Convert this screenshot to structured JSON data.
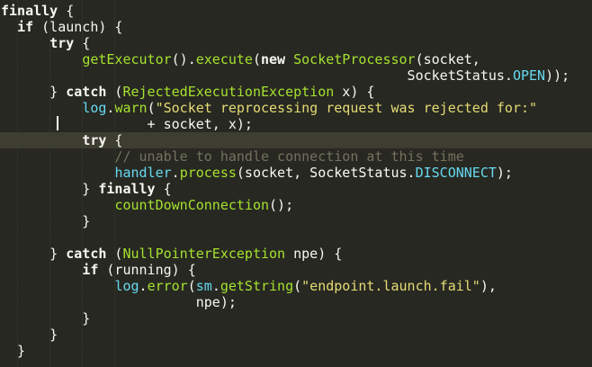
{
  "editor": {
    "lines": [
      [
        {
          "t": "finally",
          "c": "tok-kw"
        },
        {
          "t": " {",
          "c": "tok-plain"
        }
      ],
      [
        {
          "t": "  ",
          "c": "tok-plain"
        },
        {
          "t": "if",
          "c": "tok-kw"
        },
        {
          "t": " (launch) {",
          "c": "tok-plain"
        }
      ],
      [
        {
          "t": "      ",
          "c": "tok-plain"
        },
        {
          "t": "try",
          "c": "tok-kw"
        },
        {
          "t": " {",
          "c": "tok-plain"
        }
      ],
      [
        {
          "t": "          ",
          "c": "tok-plain"
        },
        {
          "t": "getExecutor",
          "c": "tok-fn"
        },
        {
          "t": "().",
          "c": "tok-plain"
        },
        {
          "t": "execute",
          "c": "tok-fn"
        },
        {
          "t": "(",
          "c": "tok-plain"
        },
        {
          "t": "new",
          "c": "tok-kw"
        },
        {
          "t": " ",
          "c": "tok-plain"
        },
        {
          "t": "SocketProcessor",
          "c": "tok-type"
        },
        {
          "t": "(socket,",
          "c": "tok-plain"
        }
      ],
      [
        {
          "t": "                                                  SocketStatus.",
          "c": "tok-plain"
        },
        {
          "t": "OPEN",
          "c": "tok-const"
        },
        {
          "t": "));",
          "c": "tok-plain"
        }
      ],
      [
        {
          "t": "      } ",
          "c": "tok-plain"
        },
        {
          "t": "catch",
          "c": "tok-kw"
        },
        {
          "t": " (",
          "c": "tok-plain"
        },
        {
          "t": "RejectedExecutionException",
          "c": "tok-type"
        },
        {
          "t": " x) {",
          "c": "tok-plain"
        }
      ],
      [
        {
          "t": "          ",
          "c": "tok-plain"
        },
        {
          "t": "log",
          "c": "tok-const"
        },
        {
          "t": ".",
          "c": "tok-plain"
        },
        {
          "t": "warn",
          "c": "tok-fn"
        },
        {
          "t": "(",
          "c": "tok-plain"
        },
        {
          "t": "\"Socket reprocessing request was rejected for:\"",
          "c": "tok-str"
        }
      ],
      [
        {
          "t": "                  + socket, x);",
          "c": "tok-plain"
        }
      ],
      [
        {
          "t": "          ",
          "c": "tok-plain"
        },
        {
          "t": "try",
          "c": "tok-kw"
        },
        {
          "t": " {",
          "c": "tok-plain"
        }
      ],
      [
        {
          "t": "              ",
          "c": "tok-plain"
        },
        {
          "t": "// unable to handle connection at this time",
          "c": "tok-cmt"
        }
      ],
      [
        {
          "t": "              ",
          "c": "tok-plain"
        },
        {
          "t": "handler",
          "c": "tok-const"
        },
        {
          "t": ".",
          "c": "tok-plain"
        },
        {
          "t": "process",
          "c": "tok-fn"
        },
        {
          "t": "(socket, SocketStatus.",
          "c": "tok-plain"
        },
        {
          "t": "DISCONNECT",
          "c": "tok-const"
        },
        {
          "t": ");",
          "c": "tok-plain"
        }
      ],
      [
        {
          "t": "          } ",
          "c": "tok-plain"
        },
        {
          "t": "finally",
          "c": "tok-kw"
        },
        {
          "t": " {",
          "c": "tok-plain"
        }
      ],
      [
        {
          "t": "              ",
          "c": "tok-plain"
        },
        {
          "t": "countDownConnection",
          "c": "tok-fn"
        },
        {
          "t": "();",
          "c": "tok-plain"
        }
      ],
      [
        {
          "t": "          }",
          "c": "tok-plain"
        }
      ],
      [
        {
          "t": "",
          "c": "tok-plain"
        }
      ],
      [
        {
          "t": "      } ",
          "c": "tok-plain"
        },
        {
          "t": "catch",
          "c": "tok-kw"
        },
        {
          "t": " (",
          "c": "tok-plain"
        },
        {
          "t": "NullPointerException",
          "c": "tok-type"
        },
        {
          "t": " npe) {",
          "c": "tok-plain"
        }
      ],
      [
        {
          "t": "          ",
          "c": "tok-plain"
        },
        {
          "t": "if",
          "c": "tok-kw"
        },
        {
          "t": " (running) {",
          "c": "tok-plain"
        }
      ],
      [
        {
          "t": "              ",
          "c": "tok-plain"
        },
        {
          "t": "log",
          "c": "tok-const"
        },
        {
          "t": ".",
          "c": "tok-plain"
        },
        {
          "t": "error",
          "c": "tok-fn"
        },
        {
          "t": "(",
          "c": "tok-plain"
        },
        {
          "t": "sm",
          "c": "tok-const"
        },
        {
          "t": ".",
          "c": "tok-plain"
        },
        {
          "t": "getString",
          "c": "tok-fn"
        },
        {
          "t": "(",
          "c": "tok-plain"
        },
        {
          "t": "\"endpoint.launch.fail\"",
          "c": "tok-str"
        },
        {
          "t": "),",
          "c": "tok-plain"
        }
      ],
      [
        {
          "t": "                        npe);",
          "c": "tok-plain"
        }
      ],
      [
        {
          "t": "          }",
          "c": "tok-plain"
        }
      ],
      [
        {
          "t": "      }",
          "c": "tok-plain"
        }
      ],
      [
        {
          "t": "  }",
          "c": "tok-plain"
        }
      ]
    ],
    "current_line": 8,
    "colors": {
      "background": "#272822",
      "current_line": "#3e3d32",
      "keyword": "#f8f8f2",
      "function": "#a6e22e",
      "string": "#e6db74",
      "comment": "#75715e",
      "constant": "#66d9ef"
    }
  }
}
